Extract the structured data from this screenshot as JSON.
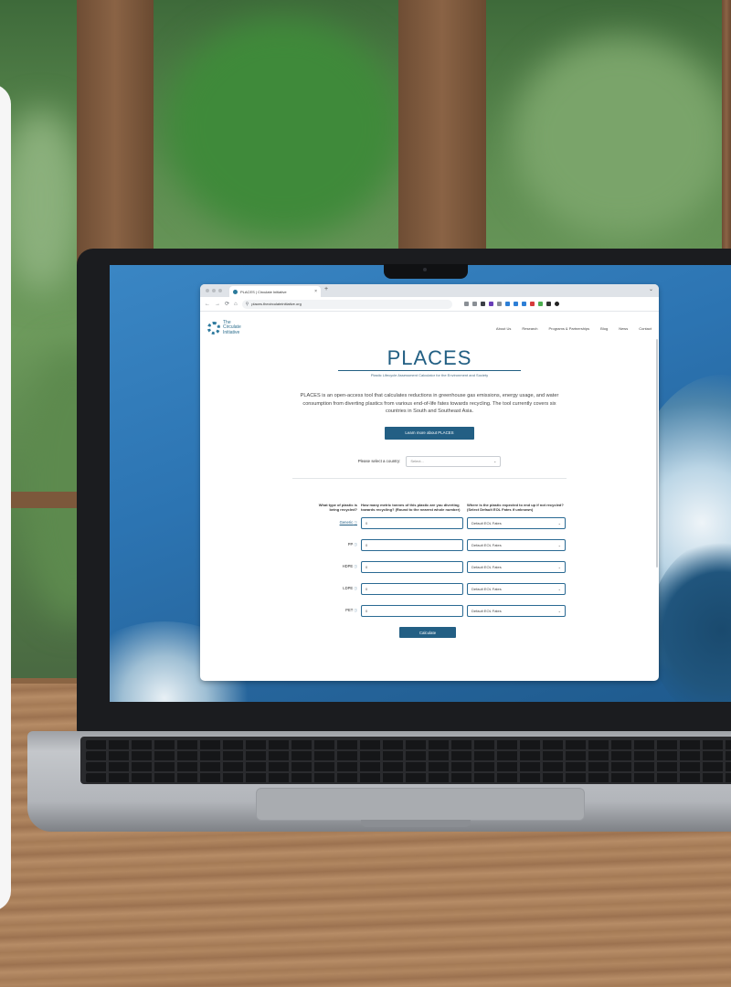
{
  "browser": {
    "tab_title": "PLACES | Circulate Initiative",
    "tab_close": "×",
    "new_tab": "+",
    "minimize": "⌄",
    "url": "places.thecirculateinitiative.org",
    "nav_back": "←",
    "nav_forward": "→",
    "nav_reload": "⟳",
    "nav_home": "⌂"
  },
  "site": {
    "logo_text": "The Circulate Initiative",
    "nav": [
      "About Us",
      "Research",
      "Programs & Partnerships",
      "Blog",
      "News",
      "Contact"
    ]
  },
  "hero": {
    "title": "PLACES",
    "subtitle": "Plastic Lifecycle Assessment Calculator for the Environment and Society",
    "intro": "PLACES is an open-access tool that calculates reductions in greenhouse gas emissions, energy usage, and water consumption from diverting plastics from various end-of-life fates towards recycling. The tool currently covers six countries in South and Southeast Asia.",
    "learn_more": "Learn more about PLACES"
  },
  "country": {
    "label": "Please select a country:",
    "placeholder": "Select..."
  },
  "calculator": {
    "headers": [
      "What type of plastic is being recycled?",
      "How many metric tonnes of this plastic are you diverting towards recycling? (Round to the nearest whole number)",
      "Where is the plastic expected to end up if not recycled? (Select Default EOL Fates if unknown)"
    ],
    "rows": [
      {
        "label": "Generic",
        "info": "ⓘ",
        "quantity": "0",
        "fate": "Default EOL Fates"
      },
      {
        "label": "PP",
        "info": "ⓘ",
        "quantity": "0",
        "fate": "Default EOL Fates"
      },
      {
        "label": "HDPE",
        "info": "ⓘ",
        "quantity": "0",
        "fate": "Default EOL Fates"
      },
      {
        "label": "LDPE",
        "info": "ⓘ",
        "quantity": "0",
        "fate": "Default EOL Fates"
      },
      {
        "label": "PET",
        "info": "ⓘ",
        "quantity": "0",
        "fate": "Default EOL Fates"
      }
    ],
    "calculate": "Calculate",
    "chevron": "⌄"
  },
  "colors": {
    "brand_blue": "#235f84",
    "screen_blue": "#2c74b2"
  }
}
